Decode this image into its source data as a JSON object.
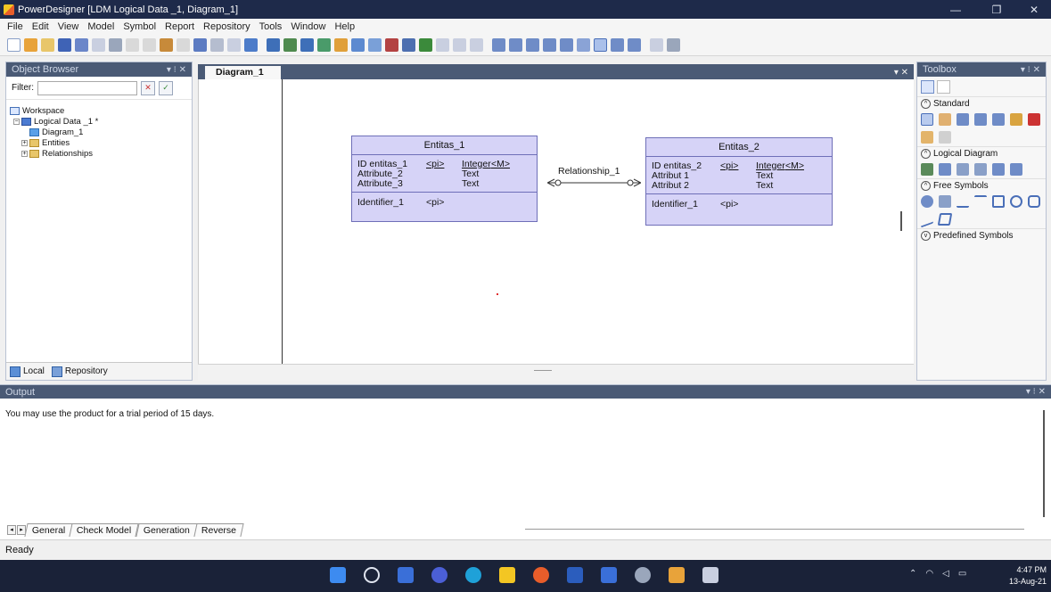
{
  "window": {
    "title": "PowerDesigner [LDM Logical Data _1, Diagram_1]",
    "minimize": "—",
    "restore": "❐",
    "close": "✕"
  },
  "menu": [
    "File",
    "Edit",
    "View",
    "Model",
    "Symbol",
    "Report",
    "Repository",
    "Tools",
    "Window",
    "Help"
  ],
  "object_browser": {
    "title": "Object Browser",
    "controls": "▾ ⁝ ✕",
    "filter_label": "Filter:",
    "filter_value": "",
    "tree": {
      "workspace": "Workspace",
      "model": "Logical Data _1 *",
      "diagram": "Diagram_1",
      "entities": "Entities",
      "relationships": "Relationships"
    },
    "tabs": [
      "Local",
      "Repository"
    ]
  },
  "diagram": {
    "tab_label": "Diagram_1",
    "tab_controls": "▾ ✕",
    "entity1": {
      "name": "Entitas_1",
      "attributes": [
        [
          "ID entitas_1",
          "<pi>",
          "Integer",
          "<M>"
        ],
        [
          "Attribute_2",
          "",
          "Text",
          ""
        ],
        [
          "Attribute_3",
          "",
          "Text",
          ""
        ]
      ],
      "identifier": [
        "Identifier_1",
        "<pi>"
      ]
    },
    "entity2": {
      "name": "Entitas_2",
      "attributes": [
        [
          "ID entitas_2",
          "<pi>",
          "Integer",
          "<M>"
        ],
        [
          "Attribut 1",
          "",
          "Text",
          ""
        ],
        [
          "Attribut 2",
          "",
          "Text",
          ""
        ]
      ],
      "identifier": [
        "Identifier_1",
        "<pi>"
      ]
    },
    "relationship": "Relationship_1"
  },
  "toolbox": {
    "title": "Toolbox",
    "controls": "▾ ⁝ ✕",
    "sections": [
      "Standard",
      "Logical Diagram",
      "Free Symbols",
      "Predefined Symbols"
    ]
  },
  "output": {
    "title": "Output",
    "controls": "▾ ⁝ ✕",
    "message": "You may use the product for a trial period of 15 days.",
    "tabs": [
      "General",
      "Check Model",
      "Generation",
      "Reverse"
    ]
  },
  "status": "Ready",
  "taskbar": {
    "time": "4:47 PM",
    "date": "13-Aug-21"
  },
  "colors": {
    "entity_fill": "#d6d3f7",
    "entity_border": "#6f6fb8",
    "panel_header": "#4a5a75",
    "taskbar": "#1a2238"
  }
}
